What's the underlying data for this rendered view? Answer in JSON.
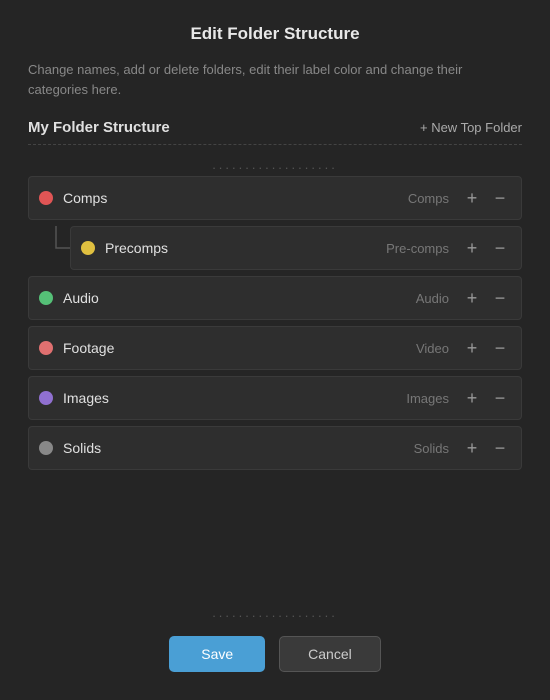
{
  "dialog": {
    "title": "Edit Folder Structure",
    "description": "Change names, add or delete folders, edit their label color and change their categories here.",
    "section_title": "My Folder Structure",
    "new_top_folder_label": "+ New Top Folder",
    "dots": "...................",
    "folders": [
      {
        "id": "comps",
        "name": "Comps",
        "category": "Comps",
        "dot_color": "#e05555",
        "indent": false
      },
      {
        "id": "precomps",
        "name": "Precomps",
        "category": "Pre-comps",
        "dot_color": "#e0c040",
        "indent": true
      },
      {
        "id": "audio",
        "name": "Audio",
        "category": "Audio",
        "dot_color": "#55c077",
        "indent": false
      },
      {
        "id": "footage",
        "name": "Footage",
        "category": "Video",
        "dot_color": "#e07070",
        "indent": false
      },
      {
        "id": "images",
        "name": "Images",
        "category": "Images",
        "dot_color": "#9070d0",
        "indent": false
      },
      {
        "id": "solids",
        "name": "Solids",
        "category": "Solids",
        "dot_color": "#888888",
        "indent": false
      }
    ],
    "footer": {
      "save_label": "Save",
      "cancel_label": "Cancel"
    }
  }
}
